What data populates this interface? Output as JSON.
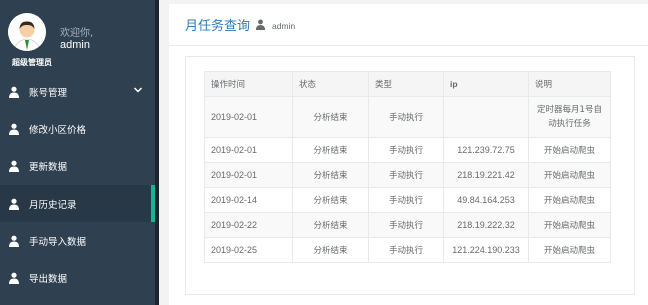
{
  "sidebar": {
    "welcome": "欢迎你,",
    "username": "admin",
    "role": "超级管理员",
    "items": [
      {
        "label": "账号管理",
        "icon": "user-icon"
      },
      {
        "label": "修改小区价格",
        "icon": "user-icon"
      },
      {
        "label": "更新数据",
        "icon": "user-icon"
      },
      {
        "label": "月历史记录",
        "icon": "user-icon"
      },
      {
        "label": "手动导入数据",
        "icon": "user-icon"
      },
      {
        "label": "导出数据",
        "icon": "user-icon"
      }
    ],
    "active_index": 3
  },
  "header": {
    "title": "月任务查询",
    "user": "admin"
  },
  "table": {
    "columns": [
      "操作时间",
      "状态",
      "类型",
      "ip",
      "说明"
    ],
    "rows": [
      {
        "time": "2019-02-01",
        "status": "分析结束",
        "type": "手动执行",
        "ip": "",
        "desc": "定时器每月1号自动执行任务"
      },
      {
        "time": "2019-02-01",
        "status": "分析结束",
        "type": "手动执行",
        "ip": "121.239.72.75",
        "desc": "开始启动爬虫"
      },
      {
        "time": "2019-02-01",
        "status": "分析结束",
        "type": "手动执行",
        "ip": "218.19.221.42",
        "desc": "开始启动爬虫"
      },
      {
        "time": "2019-02-14",
        "status": "分析结束",
        "type": "手动执行",
        "ip": "49.84.164.253",
        "desc": "开始启动爬虫"
      },
      {
        "time": "2019-02-22",
        "status": "分析结束",
        "type": "手动执行",
        "ip": "218.19.222.32",
        "desc": "开始启动爬虫"
      },
      {
        "time": "2019-02-25",
        "status": "分析结束",
        "type": "手动执行",
        "ip": "121.224.190.233",
        "desc": "开始启动爬虫"
      }
    ]
  },
  "colors": {
    "sidebar_bg": "#2f4050",
    "active_accent": "#1ab394",
    "title_blue": "#337ab7"
  }
}
